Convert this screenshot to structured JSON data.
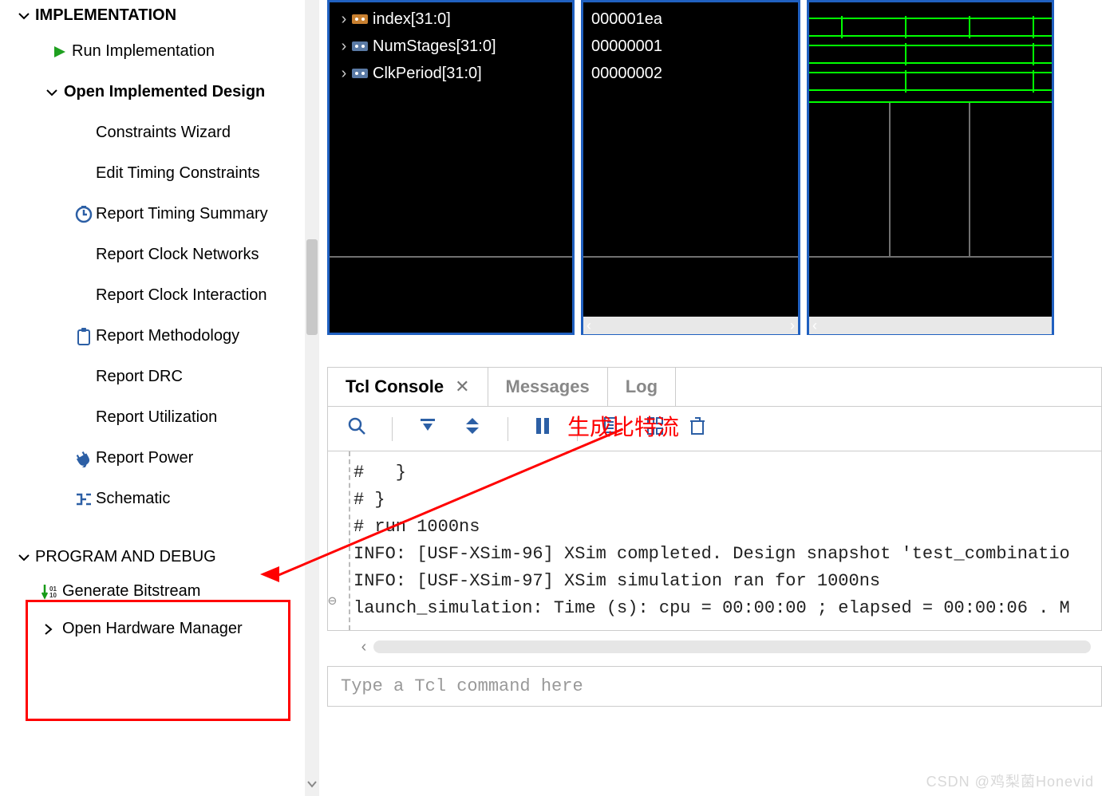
{
  "sidebar": {
    "implementation": {
      "title": "IMPLEMENTATION",
      "run": "Run Implementation",
      "open_design": "Open Implemented Design",
      "items": [
        {
          "label": "Constraints Wizard",
          "icon": ""
        },
        {
          "label": "Edit Timing Constraints",
          "icon": ""
        },
        {
          "label": "Report Timing Summary",
          "icon": "clock"
        },
        {
          "label": "Report Clock Networks",
          "icon": ""
        },
        {
          "label": "Report Clock Interaction",
          "icon": ""
        },
        {
          "label": "Report Methodology",
          "icon": "clipboard"
        },
        {
          "label": "Report DRC",
          "icon": ""
        },
        {
          "label": "Report Utilization",
          "icon": ""
        },
        {
          "label": "Report Power",
          "icon": "plug"
        },
        {
          "label": "Schematic",
          "icon": "schematic"
        }
      ]
    },
    "program": {
      "title": "PROGRAM AND DEBUG",
      "generate": "Generate Bitstream",
      "open_hw": "Open Hardware Manager"
    }
  },
  "waveform": {
    "signals": [
      {
        "name": "index[31:0]",
        "value": "000001ea"
      },
      {
        "name": "NumStages[31:0]",
        "value": "00000001"
      },
      {
        "name": "ClkPeriod[31:0]",
        "value": "00000002"
      }
    ]
  },
  "console": {
    "tabs": {
      "tcl": "Tcl Console",
      "messages": "Messages",
      "log": "Log"
    },
    "annotation": "生成比特流",
    "lines": [
      "#   }",
      "# }",
      "# run 1000ns",
      "INFO: [USF-XSim-96] XSim completed. Design snapshot 'test_combinatio",
      "INFO: [USF-XSim-97] XSim simulation ran for 1000ns",
      "launch_simulation: Time (s): cpu = 00:00:00 ; elapsed = 00:00:06 . M"
    ],
    "placeholder": "Type a Tcl command here"
  },
  "watermark": "CSDN @鸡梨菌Honevid"
}
